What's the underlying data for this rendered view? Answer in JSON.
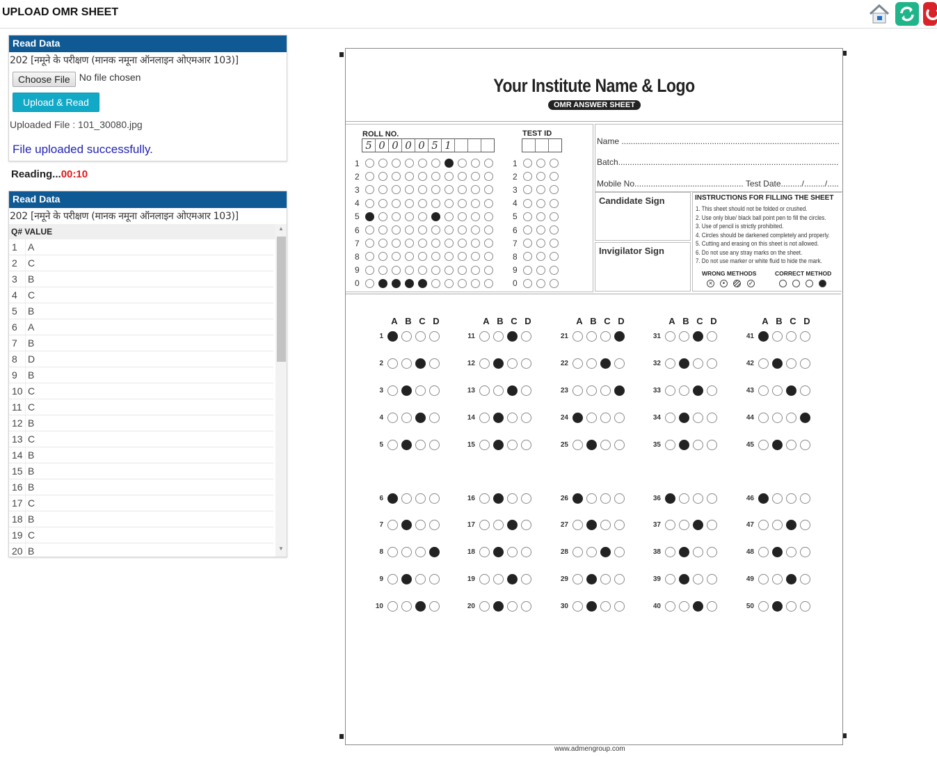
{
  "header": {
    "title": "UPLOAD OMR SHEET",
    "icons": [
      "home-icon",
      "refresh-icon",
      "power-icon"
    ]
  },
  "upload_panel": {
    "heading": "Read Data",
    "test_name": "202 [नमूने के परीक्षण (मानक नमूना ऑनलाइन ओएमआर 103)]",
    "choose_file_label": "Choose File",
    "no_file_text": "No file chosen",
    "upload_button": "Upload & Read",
    "uploaded_file": "Uploaded File : 101_30080.jpg",
    "status_message": "File uploaded successfully."
  },
  "reading": {
    "label": "Reading...",
    "timer": "00:10"
  },
  "results_panel": {
    "heading": "Read Data",
    "test_name": "202 [नमूने के परीक्षण (मानक नमूना ऑनलाइन ओएमआर 103)]",
    "columns": [
      "Q#",
      "VALUE"
    ],
    "rows": [
      {
        "q": "1",
        "v": "A"
      },
      {
        "q": "2",
        "v": "C"
      },
      {
        "q": "3",
        "v": "B"
      },
      {
        "q": "4",
        "v": "C"
      },
      {
        "q": "5",
        "v": "B"
      },
      {
        "q": "6",
        "v": "A"
      },
      {
        "q": "7",
        "v": "B"
      },
      {
        "q": "8",
        "v": "D"
      },
      {
        "q": "9",
        "v": "B"
      },
      {
        "q": "10",
        "v": "C"
      },
      {
        "q": "11",
        "v": "C"
      },
      {
        "q": "12",
        "v": "B"
      },
      {
        "q": "13",
        "v": "C"
      },
      {
        "q": "14",
        "v": "B"
      },
      {
        "q": "15",
        "v": "B"
      },
      {
        "q": "16",
        "v": "B"
      },
      {
        "q": "17",
        "v": "C"
      },
      {
        "q": "18",
        "v": "B"
      },
      {
        "q": "19",
        "v": "C"
      },
      {
        "q": "20",
        "v": "B"
      }
    ]
  },
  "omr_sheet": {
    "institute": "Your Institute Name & Logo",
    "subtitle": "OMR ANSWER SHEET",
    "roll_label": "ROLL NO.",
    "roll_handwritten": [
      "5",
      "0",
      "0",
      "0",
      "0",
      "5",
      "1",
      "",
      "",
      ""
    ],
    "roll_filled_digits": [
      5,
      0,
      0,
      0,
      0,
      5,
      1,
      null,
      null,
      null
    ],
    "row_digits": [
      "1",
      "2",
      "3",
      "4",
      "5",
      "6",
      "7",
      "8",
      "9",
      "0"
    ],
    "test_id_label": "TEST ID",
    "info_lines": [
      "Name .......................................................................................................",
      "Batch.......................................................................................................",
      "Mobile No............................................... Test Date........./........./.............."
    ],
    "candidate_sign": "Candidate Sign",
    "invigilator_sign": "Invigilator Sign",
    "instructions_title": "INSTRUCTIONS FOR FILLING THE SHEET",
    "instructions": [
      "1.  This sheet should not be folded or crushed.",
      "2.  Use only blue/ black ball point pen to fill the circles.",
      "3.  Use of pencil is strictly prohibited.",
      "4.  Circles should be darkened completely and properly.",
      "5.  Cutting and erasing on this sheet is not allowed.",
      "6.  Do not use any stray marks on the sheet.",
      "7.  Do not use marker or white fluid to hide the mark."
    ],
    "wrong_methods_label": "WRONG METHODS",
    "correct_method_label": "CORRECT METHOD",
    "options": [
      "A",
      "B",
      "C",
      "D"
    ],
    "answers": [
      "A",
      "C",
      "B",
      "C",
      "B",
      "A",
      "B",
      "D",
      "B",
      "C",
      "C",
      "B",
      "C",
      "B",
      "B",
      "B",
      "C",
      "B",
      "C",
      "B",
      "D",
      "C",
      "D",
      "A",
      "B",
      "A",
      "B",
      "C",
      "B",
      "B",
      "C",
      "B",
      "C",
      "B",
      "B",
      "A",
      "C",
      "B",
      "B",
      "C",
      "A",
      "B",
      "C",
      "D",
      "B",
      "A",
      "C",
      "B",
      "C",
      "B"
    ],
    "footer_url": "www.admengroup.com"
  }
}
